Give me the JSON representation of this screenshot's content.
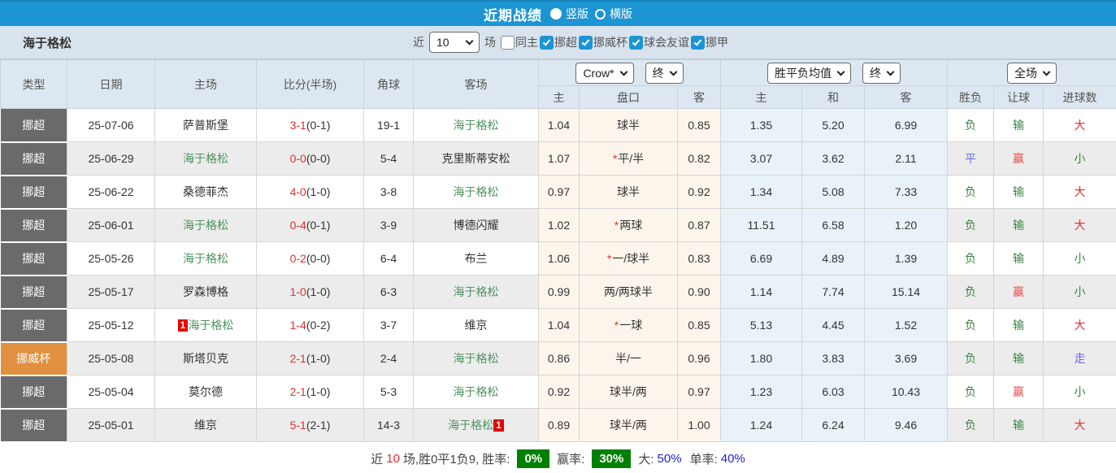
{
  "colors": {
    "accent": "#1d95d3",
    "type_bg": "#6a6a6a",
    "cup": "#e0903e",
    "asian_bg": "#fcf5ec",
    "europe_bg": "#e9f2f9",
    "team_green": "#4e9160",
    "green": "#3b8144",
    "red": "#e52e2e",
    "win_red": "#e34b4b",
    "blue": "#6a6ad8"
  },
  "topbar": {
    "title": "近期战绩",
    "radio_vertical": "竖版",
    "radio_horizontal": "横版"
  },
  "filter": {
    "team": "海于格松",
    "near_label": "近",
    "rounds_value": "10",
    "rounds_suffix": "场",
    "checkboxes": [
      {
        "label": "同主",
        "checked": false
      },
      {
        "label": "挪超",
        "checked": true
      },
      {
        "label": "挪威杯",
        "checked": true
      },
      {
        "label": "球会友谊",
        "checked": true
      },
      {
        "label": "挪甲",
        "checked": true
      }
    ]
  },
  "table": {
    "headers": {
      "type": "类型",
      "date": "日期",
      "home": "主场",
      "score": "比分(半场)",
      "corner": "角球",
      "away": "客场",
      "selects": {
        "asian_company": "Crow*",
        "asian_time": "终",
        "europe_company": "胜平负均值",
        "europe_time": "终",
        "scope": "全场"
      },
      "asian_sub": [
        "主",
        "盘口",
        "客"
      ],
      "europe_sub": [
        "主",
        "和",
        "客"
      ],
      "result_sub": [
        "胜负",
        "让球",
        "进球数"
      ]
    },
    "rows": [
      {
        "type": "挪超",
        "type_style": "league",
        "date": "25-07-06",
        "home": {
          "name": "萨普斯堡",
          "highlight": false,
          "badge": null,
          "badge_pos": null
        },
        "score": "3-1",
        "half": "(0-1)",
        "corner": "19-1",
        "away": {
          "name": "海于格松",
          "highlight": true,
          "badge": null,
          "badge_pos": null
        },
        "asian": {
          "home": "1.04",
          "star": false,
          "handicap": "球半",
          "away": "0.85"
        },
        "europe": {
          "home": "1.35",
          "draw": "5.20",
          "away": "6.99"
        },
        "result": {
          "wdl": {
            "text": "负",
            "color": "green"
          },
          "handicap": {
            "text": "输",
            "color": "green"
          },
          "goals": {
            "text": "大",
            "color": "red"
          }
        }
      },
      {
        "type": "挪超",
        "type_style": "league",
        "date": "25-06-29",
        "home": {
          "name": "海于格松",
          "highlight": true,
          "badge": null,
          "badge_pos": null
        },
        "score": "0-0",
        "half": "(0-0)",
        "corner": "5-4",
        "away": {
          "name": "克里斯蒂安松",
          "highlight": false,
          "badge": null,
          "badge_pos": null
        },
        "asian": {
          "home": "1.07",
          "star": true,
          "handicap": "平/半",
          "away": "0.82"
        },
        "europe": {
          "home": "3.07",
          "draw": "3.62",
          "away": "2.11"
        },
        "result": {
          "wdl": {
            "text": "平",
            "color": "blue"
          },
          "handicap": {
            "text": "赢",
            "color": "winred"
          },
          "goals": {
            "text": "小",
            "color": "green"
          }
        }
      },
      {
        "type": "挪超",
        "type_style": "league",
        "date": "25-06-22",
        "home": {
          "name": "桑德菲杰",
          "highlight": false,
          "badge": null,
          "badge_pos": null
        },
        "score": "4-0",
        "half": "(1-0)",
        "corner": "3-8",
        "away": {
          "name": "海于格松",
          "highlight": true,
          "badge": null,
          "badge_pos": null
        },
        "asian": {
          "home": "0.97",
          "star": false,
          "handicap": "球半",
          "away": "0.92"
        },
        "europe": {
          "home": "1.34",
          "draw": "5.08",
          "away": "7.33"
        },
        "result": {
          "wdl": {
            "text": "负",
            "color": "green"
          },
          "handicap": {
            "text": "输",
            "color": "green"
          },
          "goals": {
            "text": "大",
            "color": "red"
          }
        }
      },
      {
        "type": "挪超",
        "type_style": "league",
        "date": "25-06-01",
        "home": {
          "name": "海于格松",
          "highlight": true,
          "badge": null,
          "badge_pos": null
        },
        "score": "0-4",
        "half": "(0-1)",
        "corner": "3-9",
        "away": {
          "name": "博德闪耀",
          "highlight": false,
          "badge": null,
          "badge_pos": null
        },
        "asian": {
          "home": "1.02",
          "star": true,
          "handicap": "两球",
          "away": "0.87"
        },
        "europe": {
          "home": "11.51",
          "draw": "6.58",
          "away": "1.20"
        },
        "result": {
          "wdl": {
            "text": "负",
            "color": "green"
          },
          "handicap": {
            "text": "输",
            "color": "green"
          },
          "goals": {
            "text": "大",
            "color": "red"
          }
        }
      },
      {
        "type": "挪超",
        "type_style": "league",
        "date": "25-05-26",
        "home": {
          "name": "海于格松",
          "highlight": true,
          "badge": null,
          "badge_pos": null
        },
        "score": "0-2",
        "half": "(0-0)",
        "corner": "6-4",
        "away": {
          "name": "布兰",
          "highlight": false,
          "badge": null,
          "badge_pos": null
        },
        "asian": {
          "home": "1.06",
          "star": true,
          "handicap": "一/球半",
          "away": "0.83"
        },
        "europe": {
          "home": "6.69",
          "draw": "4.89",
          "away": "1.39"
        },
        "result": {
          "wdl": {
            "text": "负",
            "color": "green"
          },
          "handicap": {
            "text": "输",
            "color": "green"
          },
          "goals": {
            "text": "小",
            "color": "green"
          }
        }
      },
      {
        "type": "挪超",
        "type_style": "league",
        "date": "25-05-17",
        "home": {
          "name": "罗森博格",
          "highlight": false,
          "badge": null,
          "badge_pos": null
        },
        "score": "1-0",
        "half": "(1-0)",
        "corner": "6-3",
        "away": {
          "name": "海于格松",
          "highlight": true,
          "badge": null,
          "badge_pos": null
        },
        "asian": {
          "home": "0.99",
          "star": false,
          "handicap": "两/两球半",
          "away": "0.90"
        },
        "europe": {
          "home": "1.14",
          "draw": "7.74",
          "away": "15.14"
        },
        "result": {
          "wdl": {
            "text": "负",
            "color": "green"
          },
          "handicap": {
            "text": "赢",
            "color": "winred"
          },
          "goals": {
            "text": "小",
            "color": "green"
          }
        }
      },
      {
        "type": "挪超",
        "type_style": "league",
        "date": "25-05-12",
        "home": {
          "name": "海于格松",
          "highlight": true,
          "badge": "1",
          "badge_pos": "before"
        },
        "score": "1-4",
        "half": "(0-2)",
        "corner": "3-7",
        "away": {
          "name": "维京",
          "highlight": false,
          "badge": null,
          "badge_pos": null
        },
        "asian": {
          "home": "1.04",
          "star": true,
          "handicap": "一球",
          "away": "0.85"
        },
        "europe": {
          "home": "5.13",
          "draw": "4.45",
          "away": "1.52"
        },
        "result": {
          "wdl": {
            "text": "负",
            "color": "green"
          },
          "handicap": {
            "text": "输",
            "color": "green"
          },
          "goals": {
            "text": "大",
            "color": "red"
          }
        }
      },
      {
        "type": "挪威杯",
        "type_style": "cup",
        "date": "25-05-08",
        "home": {
          "name": "斯塔贝克",
          "highlight": false,
          "badge": null,
          "badge_pos": null
        },
        "score": "2-1",
        "half": "(1-0)",
        "corner": "2-4",
        "away": {
          "name": "海于格松",
          "highlight": true,
          "badge": null,
          "badge_pos": null
        },
        "asian": {
          "home": "0.86",
          "star": false,
          "handicap": "半/一",
          "away": "0.96"
        },
        "europe": {
          "home": "1.80",
          "draw": "3.83",
          "away": "3.69"
        },
        "result": {
          "wdl": {
            "text": "负",
            "color": "green"
          },
          "handicap": {
            "text": "输",
            "color": "green"
          },
          "goals": {
            "text": "走",
            "color": "blue"
          }
        }
      },
      {
        "type": "挪超",
        "type_style": "league",
        "date": "25-05-04",
        "home": {
          "name": "莫尔德",
          "highlight": false,
          "badge": null,
          "badge_pos": null
        },
        "score": "2-1",
        "half": "(1-0)",
        "corner": "5-3",
        "away": {
          "name": "海于格松",
          "highlight": true,
          "badge": null,
          "badge_pos": null
        },
        "asian": {
          "home": "0.92",
          "star": false,
          "handicap": "球半/两",
          "away": "0.97"
        },
        "europe": {
          "home": "1.23",
          "draw": "6.03",
          "away": "10.43"
        },
        "result": {
          "wdl": {
            "text": "负",
            "color": "green"
          },
          "handicap": {
            "text": "赢",
            "color": "winred"
          },
          "goals": {
            "text": "小",
            "color": "green"
          }
        }
      },
      {
        "type": "挪超",
        "type_style": "league",
        "date": "25-05-01",
        "home": {
          "name": "维京",
          "highlight": false,
          "badge": null,
          "badge_pos": null
        },
        "score": "5-1",
        "half": "(2-1)",
        "corner": "14-3",
        "away": {
          "name": "海于格松",
          "highlight": true,
          "badge": "1",
          "badge_pos": "after"
        },
        "asian": {
          "home": "0.89",
          "star": false,
          "handicap": "球半/两",
          "away": "1.00"
        },
        "europe": {
          "home": "1.24",
          "draw": "6.24",
          "away": "9.46"
        },
        "result": {
          "wdl": {
            "text": "负",
            "color": "green"
          },
          "handicap": {
            "text": "输",
            "color": "green"
          },
          "goals": {
            "text": "大",
            "color": "red"
          }
        }
      }
    ]
  },
  "summary": {
    "near_label": "近",
    "count": "10",
    "record_text": "场,胜0平1负9,",
    "winrate_label": "胜率:",
    "winrate_value": "0%",
    "profit_label": "赢率:",
    "profit_value": "30%",
    "big_label": "大:",
    "big_value": "50%",
    "single_label": "单率:",
    "single_value": "40%"
  }
}
